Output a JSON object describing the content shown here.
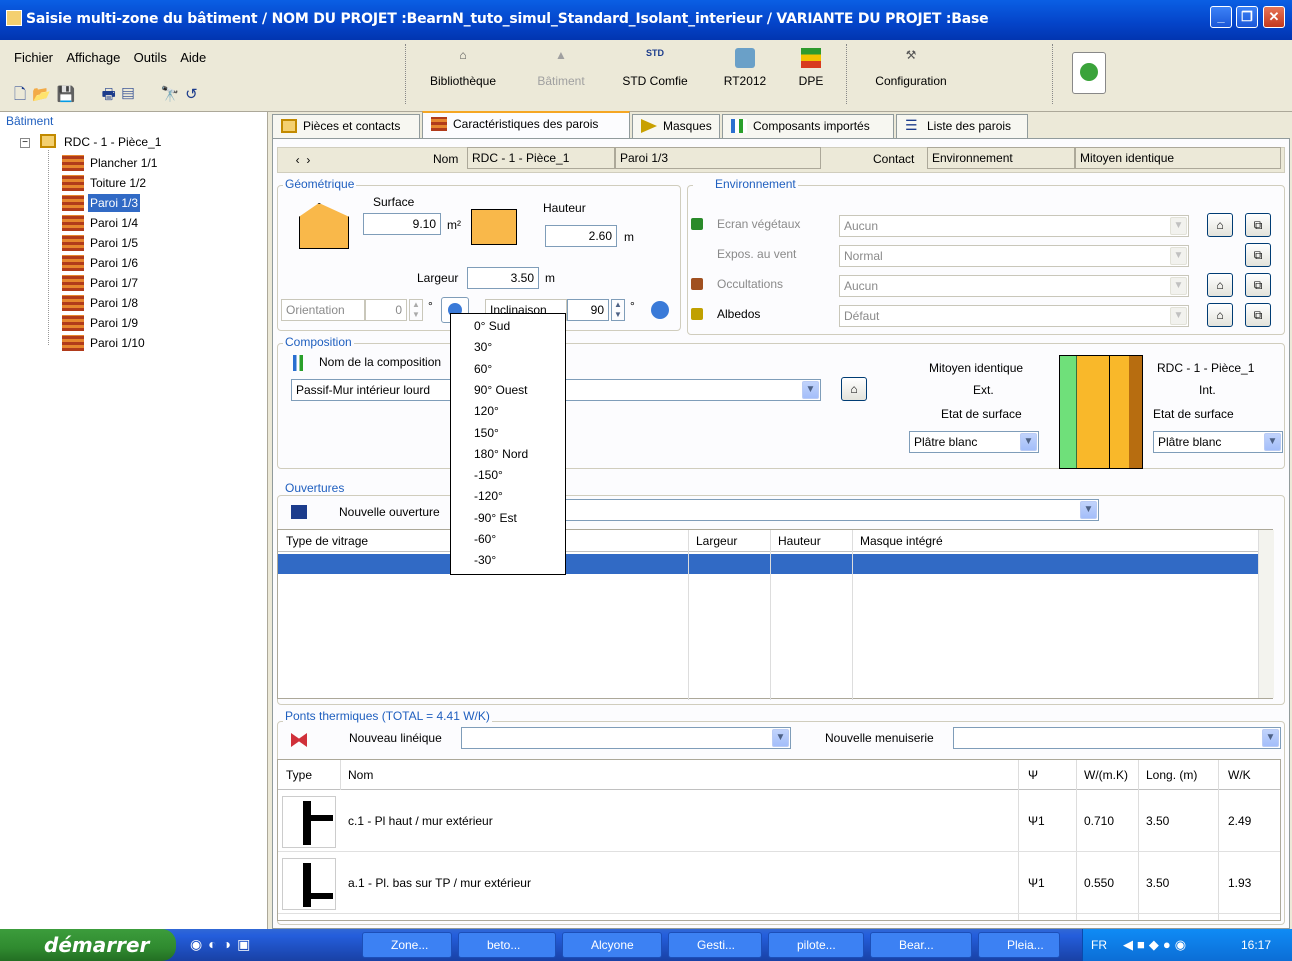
{
  "window": {
    "title": "Saisie multi-zone du bâtiment  /  NOM DU PROJET :BearnN_tuto_simul_Standard_Isolant_interieur  /  VARIANTE DU PROJET :Base"
  },
  "menu": [
    "Fichier",
    "Affichage",
    "Outils",
    "Aide"
  ],
  "toolbar": {
    "bibliotheque": "Bibliothèque",
    "batiment": "Bâtiment",
    "std_comfie": "STD Comfie",
    "rt2012": "RT2012",
    "dpe": "DPE",
    "configuration": "Configuration"
  },
  "tree": {
    "header": "Bâtiment",
    "root": "RDC - 1 - Pièce_1",
    "items": [
      "Plancher 1/1",
      "Toiture 1/2",
      "Paroi 1/3",
      "Paroi 1/4",
      "Paroi 1/5",
      "Paroi 1/6",
      "Paroi 1/7",
      "Paroi 1/8",
      "Paroi 1/9",
      "Paroi 1/10"
    ],
    "selected": "Paroi 1/3"
  },
  "tabs": [
    "Pièces et contacts",
    "Caractéristiques des parois",
    "Masques",
    "Composants importés",
    "Liste des parois"
  ],
  "header": {
    "nom_label": "Nom",
    "nom_value": "RDC - 1 - Pièce_1",
    "paroi_value": "Paroi 1/3",
    "contact_label": "Contact",
    "contact_value": "Environnement",
    "contact_type": "Mitoyen identique"
  },
  "geometrique": {
    "title": "Géométrique",
    "surface_label": "Surface",
    "surface_value": "9.10",
    "surface_unit": "m²",
    "hauteur_label": "Hauteur",
    "hauteur_value": "2.60",
    "hauteur_unit": "m",
    "largeur_label": "Largeur",
    "largeur_value": "3.50",
    "largeur_unit": "m",
    "orientation_label": "Orientation",
    "orientation_value": "0",
    "degree": "°",
    "inclinaison_label": "Inclinaison",
    "inclinaison_value": "90"
  },
  "environnement": {
    "title": "Environnement",
    "rows": [
      {
        "label": "Ecran végétaux",
        "value": "Aucun"
      },
      {
        "label": "Expos. au vent",
        "value": "Normal"
      },
      {
        "label": "Occultations",
        "value": "Aucun"
      },
      {
        "label": "Albedos",
        "value": "Défaut"
      }
    ]
  },
  "composition": {
    "title": "Composition",
    "nom_label": "Nom de la composition",
    "value": "Passif-Mur intérieur lourd",
    "left_side": "Mitoyen identique",
    "left_sub": "Ext.",
    "right_side": "RDC - 1 - Pièce_1",
    "right_sub": "Int.",
    "etat_label": "Etat de surface",
    "etat_left": "Plâtre blanc",
    "etat_right": "Plâtre blanc"
  },
  "ouvertures": {
    "title": "Ouvertures",
    "nouvelle_label": "Nouvelle ouverture",
    "columns": [
      "Type de vitrage",
      "Largeur",
      "Hauteur",
      "Masque intégré"
    ]
  },
  "ponts": {
    "title": "Ponts thermiques (TOTAL = 4.41 W/K)",
    "nouveau_label": "Nouveau linéique",
    "menuiserie_label": "Nouvelle menuiserie",
    "columns": [
      "Type",
      "Nom",
      "Ψ",
      "W/(m.K)",
      "Long. (m)",
      "W/K"
    ],
    "rows": [
      {
        "nom": "c.1 - Pl haut / mur extérieur",
        "psi": "Ψ1",
        "wmk": "0.710",
        "long": "3.50",
        "wk": "2.49"
      },
      {
        "nom": "a.1 - Pl. bas sur TP / mur extérieur",
        "psi": "Ψ1",
        "wmk": "0.550",
        "long": "3.50",
        "wk": "1.93"
      }
    ]
  },
  "orientation_popup": [
    "0° Sud",
    "30°",
    "60°",
    "90° Ouest",
    "120°",
    "150°",
    "180° Nord",
    "-150°",
    "-120°",
    "-90° Est",
    "-60°",
    "-30°"
  ],
  "taskbar": {
    "start": "démarrer",
    "buttons": [
      "Zone...",
      "beto...",
      "Alcyone",
      "Gesti...",
      "pilote...",
      "Bear...",
      "Pleia..."
    ],
    "lang": "FR",
    "clock": "16:17"
  }
}
